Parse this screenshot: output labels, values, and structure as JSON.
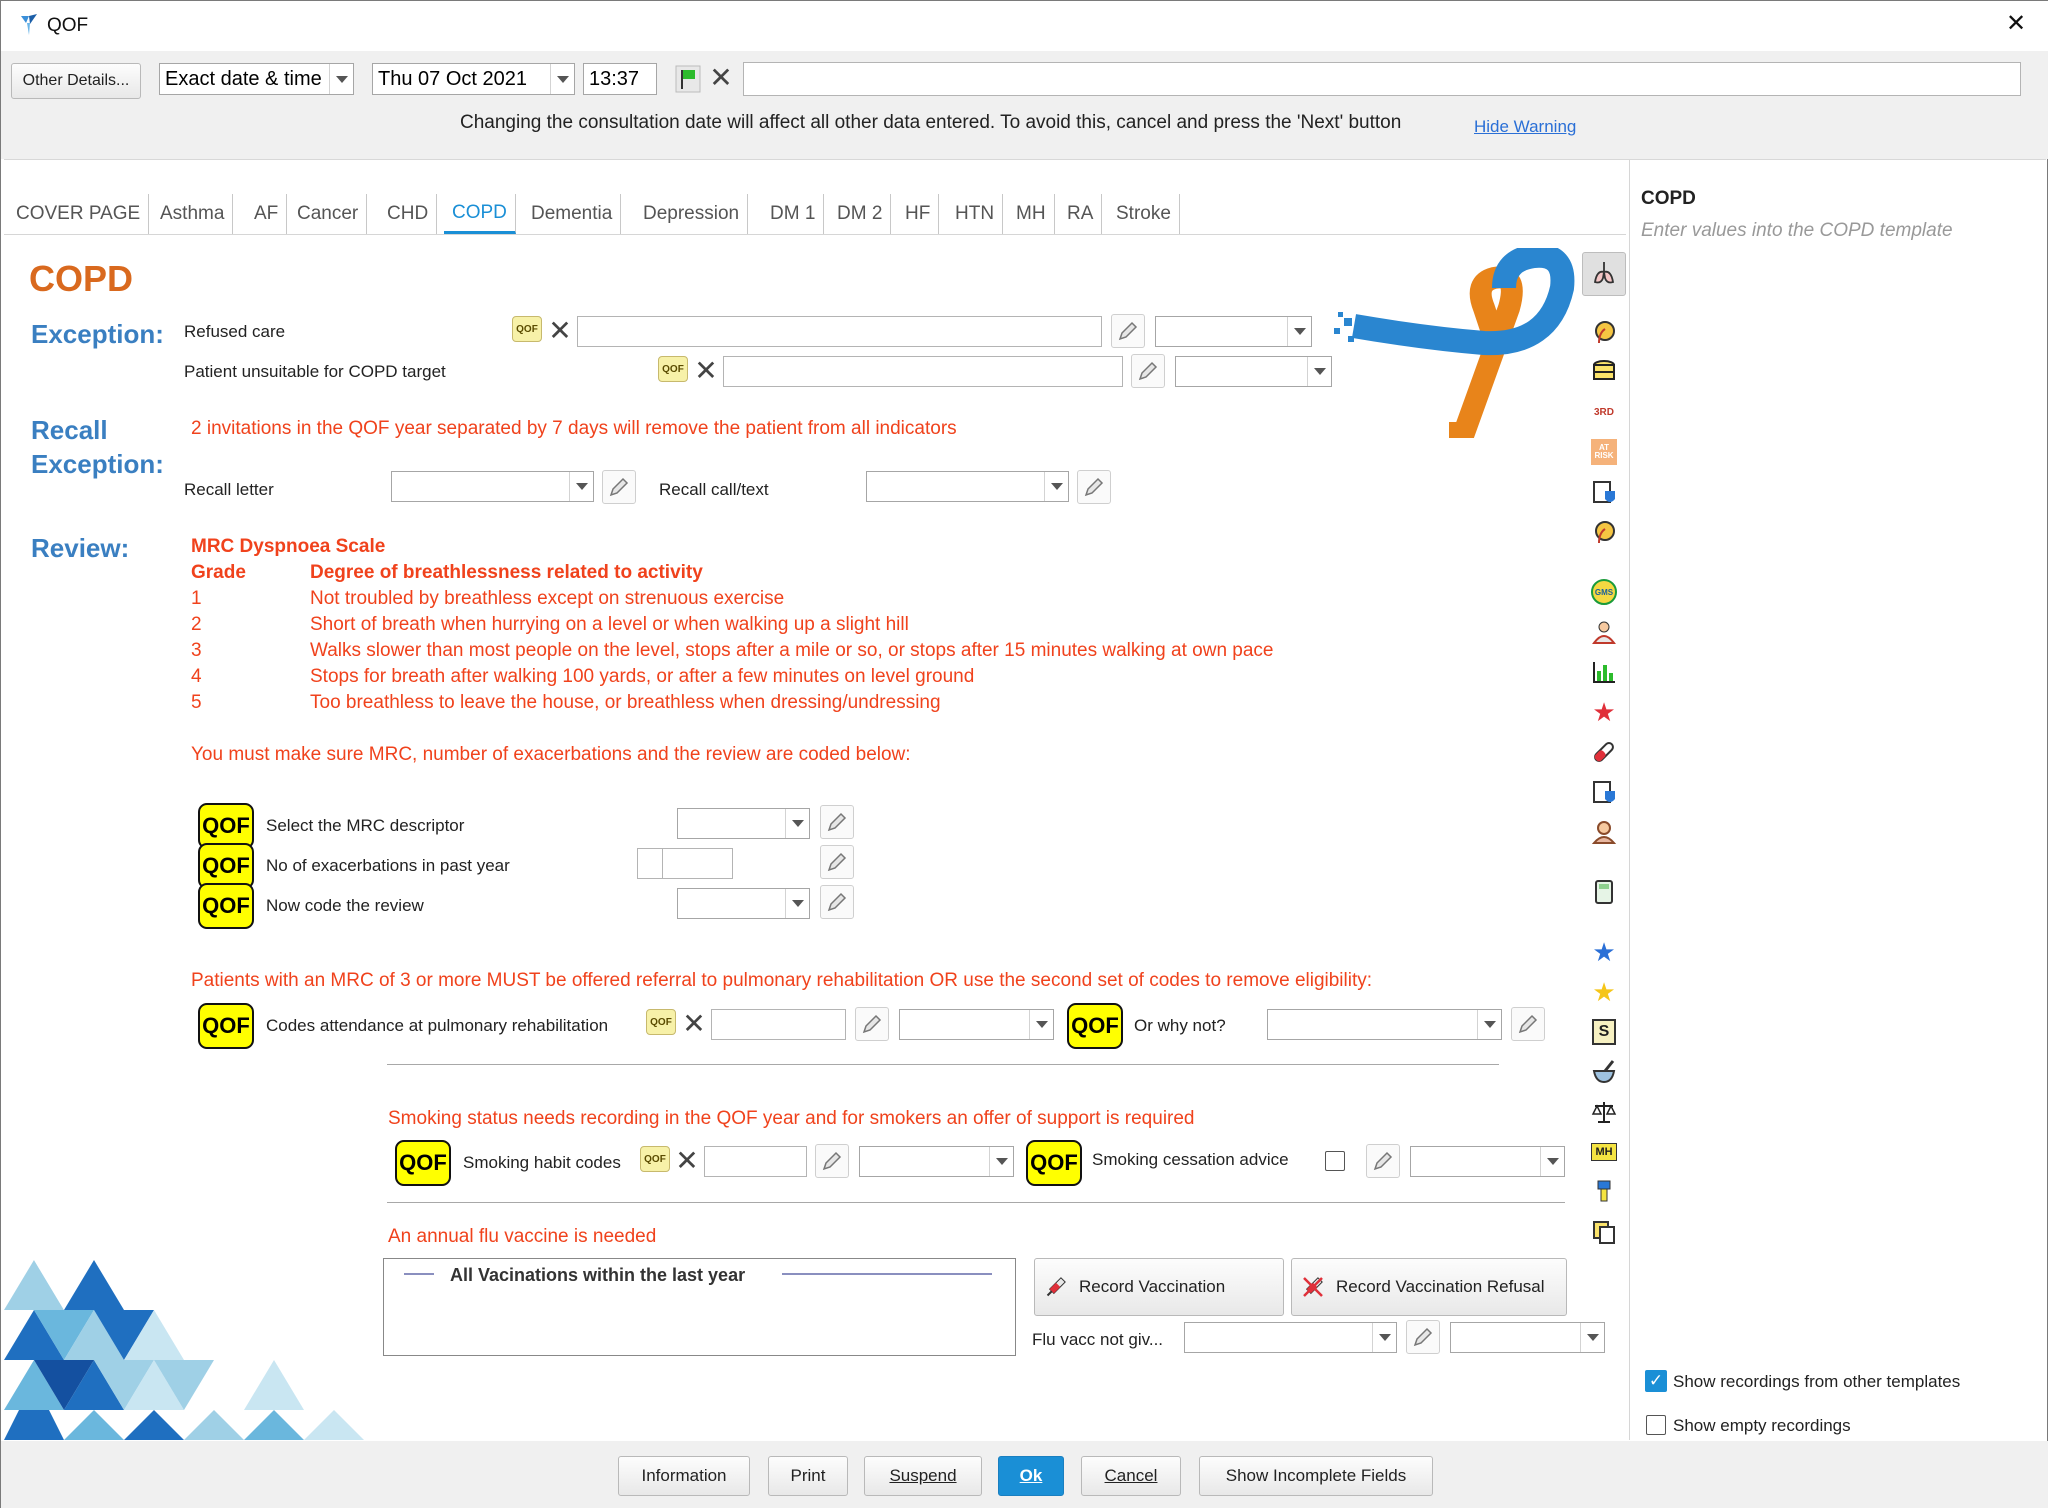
{
  "window": {
    "title": "QOF",
    "close_glyph": "✕"
  },
  "toolbar": {
    "other_details_label": "Other Details...",
    "date_mode": "Exact date & time",
    "date": "Thu 07 Oct 2021",
    "time": "13:37",
    "warning": "Changing the consultation date will affect all other data entered. To avoid this, cancel and press the 'Next' button",
    "hide_warning": "Hide Warning"
  },
  "tabs": [
    "COVER PAGE",
    "Asthma",
    "AF",
    "Cancer",
    "CHD",
    "COPD",
    "Dementia",
    "Depression",
    "DM 1",
    "DM 2",
    "HF",
    "HTN",
    "MH",
    "RA",
    "Stroke"
  ],
  "active_tab": "COPD",
  "side_panel": {
    "title": "COPD",
    "subtitle": "Enter values into the COPD template",
    "show_other_templates": "Show recordings from other templates",
    "show_empty": "Show empty recordings"
  },
  "page": {
    "title": "COPD",
    "qof_badge": "QOF",
    "qof_small": "QOF",
    "x_glyph": "✕",
    "exception": {
      "heading": "Exception:",
      "refused_care": "Refused care",
      "unsuitable": "Patient unsuitable for COPD target"
    },
    "recall": {
      "heading": "Recall Exception:",
      "note": "2 invitations in the QOF year separated by 7 days will remove the patient from all indicators",
      "letter": "Recall letter",
      "call_text": "Recall call/text"
    },
    "review": {
      "heading": "Review:",
      "mrc_title": "MRC Dyspnoea Scale",
      "grade_header": "Grade",
      "degree_header": "Degree of breathlessness related to activity",
      "grades": [
        {
          "grade": "1",
          "text": "Not troubled by breathless except on strenuous exercise"
        },
        {
          "grade": "2",
          "text": "Short of breath when hurrying on a level or when walking up a slight hill"
        },
        {
          "grade": "3",
          "text": "Walks slower than most people on the level, stops after a mile or so, or stops after 15 minutes walking at own pace"
        },
        {
          "grade": "4",
          "text": "Stops for breath after walking 100 yards, or after a few minutes on level ground"
        },
        {
          "grade": "5",
          "text": "Too breathless to leave the house, or breathless when dressing/undressing"
        }
      ],
      "must_code": "You must make sure MRC, number of exacerbations and the review are coded below:",
      "mrc_descriptor": "Select the MRC descriptor",
      "exacerbations": "No of exacerbations in past year",
      "code_review": "Now code the review",
      "rehab_note": "Patients with an MRC of 3 or more MUST be offered referral to pulmonary rehabilitation OR use the second set of codes to remove eligibility:",
      "rehab_codes": "Codes attendance at pulmonary rehabilitation",
      "why_not": "Or why not?",
      "smoking_note": "Smoking status needs recording in the QOF year and for smokers an offer of support is required",
      "smoking_codes": "Smoking habit codes",
      "cessation": "Smoking cessation advice",
      "flu_note": "An annual flu vaccine is needed",
      "vacc_box_title": "All Vacinations within the last year",
      "record_vacc": "Record Vaccination",
      "record_refusal": "Record Vaccination Refusal",
      "flu_not_given": "Flu vacc not giv..."
    }
  },
  "footer": {
    "buttons": [
      "Information",
      "Print",
      "Suspend",
      "Ok",
      "Cancel",
      "Show Incomplete Fields"
    ]
  },
  "colors": {
    "accent": "#1a8fd6",
    "heading": "#3a7fc1",
    "title": "#d9691e",
    "note_red": "#f0421c",
    "qof_yellow": "#ffff00"
  },
  "right_icons": [
    "lungs-icon",
    "head-profile-icon",
    "database-icon",
    "3rd-dose-icon",
    "at-risk-icon",
    "clipboard-shield-icon",
    "head-profile-icon",
    "gms-icon",
    "patient-icon",
    "bar-chart-icon",
    "star-red-icon",
    "pill-icon",
    "clipboard-shield-icon",
    "person-icon",
    "calculator-icon",
    "star-blue-icon",
    "star-yellow-icon",
    "scroll-icon",
    "mortar-icon",
    "scales-icon",
    "mh-icon",
    "thermometer-icon",
    "copy-icon"
  ]
}
